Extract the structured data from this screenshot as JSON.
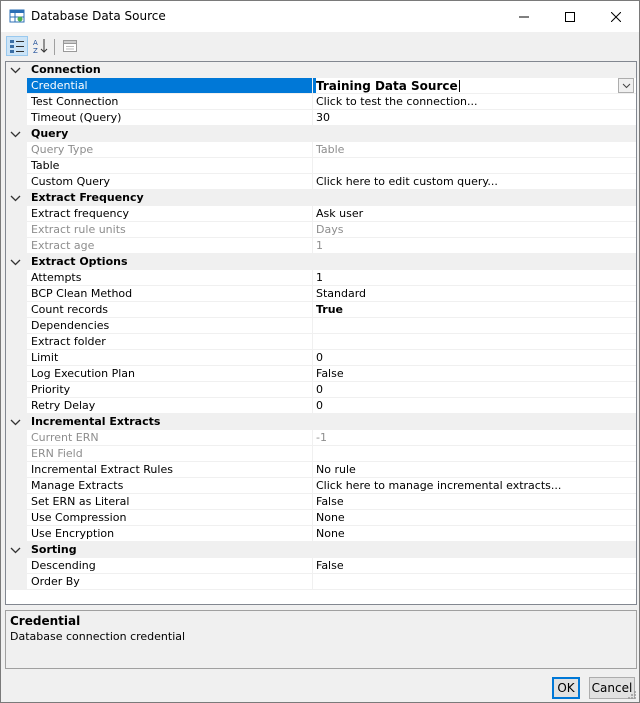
{
  "window": {
    "title": "Database Data Source",
    "icons": {
      "app": "grid-app-icon",
      "minimize": "minimize-icon",
      "maximize": "maximize-icon",
      "close": "close-icon"
    }
  },
  "toolbar": {
    "categorized_icon": "categorized-view-icon",
    "alphabetical_icon": "sort-az-icon",
    "property_pages_icon": "property-pages-icon"
  },
  "grid": {
    "categories": [
      {
        "name": "Connection",
        "rows": [
          {
            "name": "Credential",
            "value": "Training Data Source",
            "selected": true,
            "editing": true
          },
          {
            "name": "Test Connection",
            "value": "Click to test the connection..."
          },
          {
            "name": "Timeout (Query)",
            "value": "30"
          }
        ]
      },
      {
        "name": "Query",
        "rows": [
          {
            "name": "Query Type",
            "value": "Table",
            "disabled": true
          },
          {
            "name": "Table",
            "value": ""
          },
          {
            "name": "Custom Query",
            "value": "Click here to edit custom query..."
          }
        ]
      },
      {
        "name": "Extract Frequency",
        "rows": [
          {
            "name": "Extract frequency",
            "value": "Ask user"
          },
          {
            "name": "Extract rule units",
            "value": "Days",
            "disabled": true
          },
          {
            "name": "Extract age",
            "value": "1",
            "disabled": true
          }
        ]
      },
      {
        "name": "Extract Options",
        "rows": [
          {
            "name": "Attempts",
            "value": "1"
          },
          {
            "name": "BCP Clean Method",
            "value": "Standard"
          },
          {
            "name": "Count records",
            "value": "True",
            "bold": true
          },
          {
            "name": "Dependencies",
            "value": ""
          },
          {
            "name": "Extract folder",
            "value": ""
          },
          {
            "name": "Limit",
            "value": "0"
          },
          {
            "name": "Log Execution Plan",
            "value": "False"
          },
          {
            "name": "Priority",
            "value": "0"
          },
          {
            "name": "Retry Delay",
            "value": "0"
          }
        ]
      },
      {
        "name": "Incremental Extracts",
        "rows": [
          {
            "name": "Current ERN",
            "value": "-1",
            "disabled": true
          },
          {
            "name": "ERN Field",
            "value": "",
            "disabled": true
          },
          {
            "name": "Incremental Extract Rules",
            "value": "No rule"
          },
          {
            "name": "Manage Extracts",
            "value": "Click here to manage incremental extracts..."
          },
          {
            "name": "Set ERN as Literal",
            "value": "False"
          },
          {
            "name": "Use Compression",
            "value": "None"
          },
          {
            "name": "Use Encryption",
            "value": "None"
          }
        ]
      },
      {
        "name": "Sorting",
        "rows": [
          {
            "name": "Descending",
            "value": "False"
          },
          {
            "name": "Order By",
            "value": ""
          }
        ]
      }
    ]
  },
  "description": {
    "title": "Credential",
    "text": "Database connection credential"
  },
  "buttons": {
    "ok": "OK",
    "cancel": "Cancel"
  }
}
